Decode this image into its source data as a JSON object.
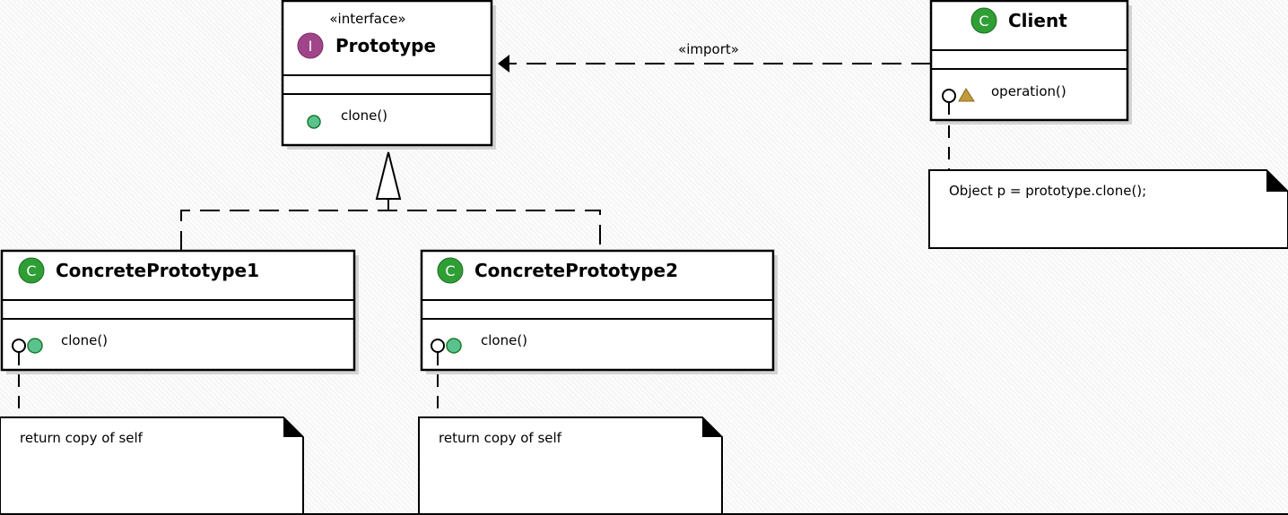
{
  "classes": {
    "prototype": {
      "stereotype": "«interface»",
      "badge": "I",
      "name": "Prototype",
      "methods": [
        "clone()"
      ]
    },
    "client": {
      "badge": "C",
      "name": "Client",
      "methods": [
        "operation()"
      ]
    },
    "concrete1": {
      "badge": "C",
      "name": "ConcretePrototype1",
      "methods": [
        "clone()"
      ]
    },
    "concrete2": {
      "badge": "C",
      "name": "ConcretePrototype2",
      "methods": [
        "clone()"
      ]
    }
  },
  "relations": {
    "import_label": "«import»"
  },
  "notes": {
    "client": "Object p = prototype.clone();",
    "concrete1": "return copy of self",
    "concrete2": "return copy of self"
  },
  "colors": {
    "interface_badge": "#a0458a",
    "class_badge": "#2e9e35",
    "public_method": "#5ac28f",
    "protected_method": "#c29a3c"
  }
}
